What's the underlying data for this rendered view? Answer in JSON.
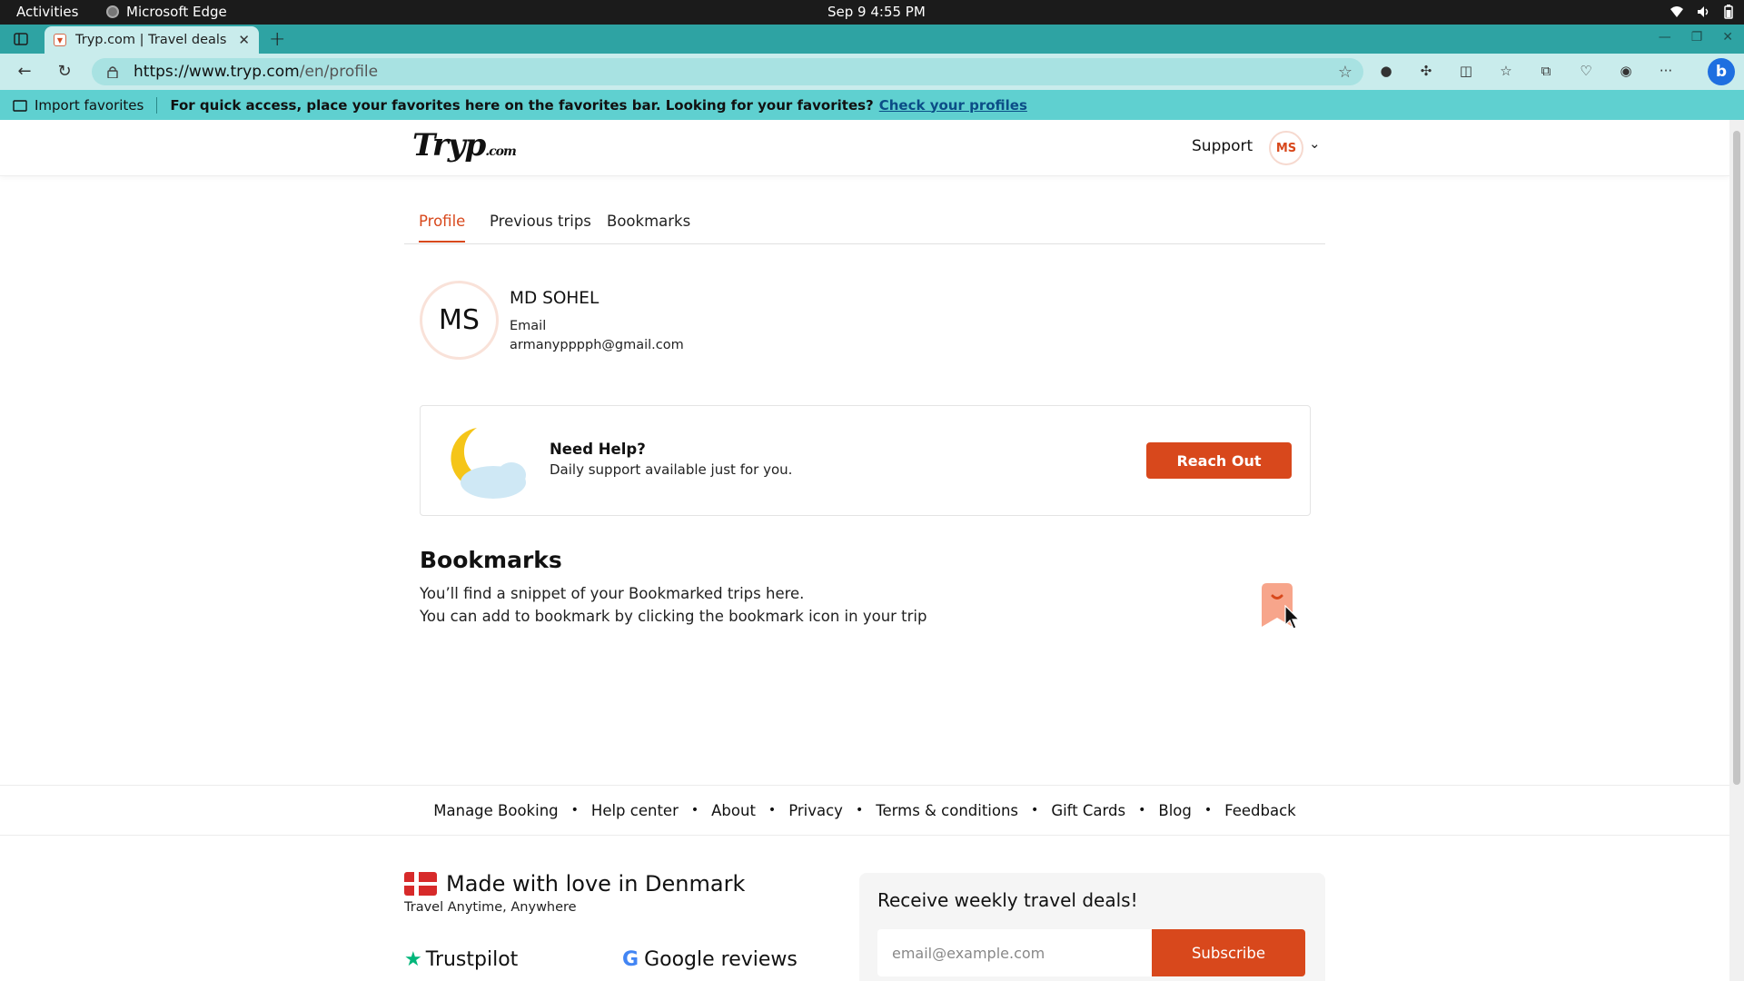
{
  "system_bar": {
    "activities": "Activities",
    "app_name": "Microsoft Edge",
    "clock": "Sep 9  4:55 PM"
  },
  "browser": {
    "tab_title": "Tryp.com | Travel deals in",
    "url_host": "https://www.tryp.com",
    "url_path": "/en/profile",
    "favorites_bar": {
      "import_label": "Import favorites",
      "message": "For quick access, place your favorites here on the favorites bar. Looking for your favorites?",
      "link_label": "Check your profiles"
    }
  },
  "site_header": {
    "logo_text": "Tryp",
    "logo_suffix": ".com",
    "support_label": "Support",
    "avatar_initials": "MS"
  },
  "profile_tabs": [
    {
      "label": "Profile",
      "active": true
    },
    {
      "label": "Previous trips",
      "active": false
    },
    {
      "label": "Bookmarks",
      "active": false
    }
  ],
  "profile": {
    "initials": "MS",
    "name": "MD SOHEL",
    "email_label": "Email",
    "email_value": "armanypppph@gmail.com"
  },
  "help_card": {
    "title": "Need Help?",
    "subtitle": "Daily support available just for you.",
    "button_label": "Reach Out"
  },
  "bookmarks_section": {
    "heading": "Bookmarks",
    "line1": "You’ll find a snippet of your Bookmarked trips here.",
    "line2": "You can add to bookmark by clicking the bookmark icon in your trip"
  },
  "footer_links": [
    "Manage Booking",
    "Help center",
    "About",
    "Privacy",
    "Terms & conditions",
    "Gift Cards",
    "Blog",
    "Feedback"
  ],
  "footer": {
    "made_with_love": "Made with love in Denmark",
    "tagline": "Travel Anytime, Anywhere",
    "trustpilot": "Trustpilot",
    "google_reviews": "Google reviews"
  },
  "newsletter": {
    "title": "Receive weekly travel deals!",
    "email_placeholder": "email@example.com",
    "subscribe_label": "Subscribe"
  },
  "colors": {
    "brand_accent": "#d8481c",
    "tab_strip": "#2ea3a3",
    "address_row": "#c9ecec",
    "favorites_bar": "#5fd0d0"
  }
}
